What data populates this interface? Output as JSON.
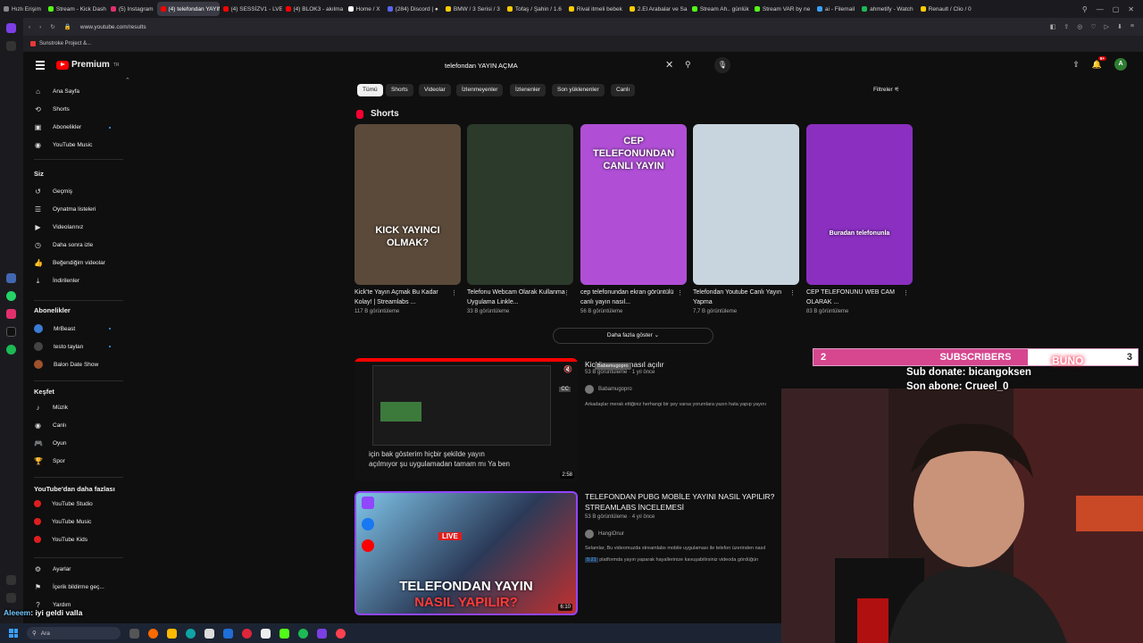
{
  "browser": {
    "tabs": [
      {
        "label": "Hızlı Erişim",
        "color": "#888888"
      },
      {
        "label": "Stream - Kick Dash",
        "color": "#53fc18"
      },
      {
        "label": "(5) Instagram",
        "color": "#e1306c"
      },
      {
        "label": "(4) telefondan YAYIN AÇM",
        "color": "#ff0000",
        "active": true
      },
      {
        "label": "(4) SESSİZV1 - LVE",
        "color": "#ff0000"
      },
      {
        "label": "(4) BLOK3 - akılma",
        "color": "#ff0000"
      },
      {
        "label": "Home / X",
        "color": "#ffffff"
      },
      {
        "label": "(284) Discord | ●",
        "color": "#5865f2"
      },
      {
        "label": "BMW / 3 Serisi / 3",
        "color": "#ffcc00"
      },
      {
        "label": "Tofaş / Şahin / 1.6",
        "color": "#ffcc00"
      },
      {
        "label": "Rival itmeli bebek",
        "color": "#ffcc00"
      },
      {
        "label": "2.El Arabalar ve Sa",
        "color": "#ffcc00"
      },
      {
        "label": "Stream Ah.. günlük",
        "color": "#53fc18"
      },
      {
        "label": "Stream VAR by ne",
        "color": "#53fc18"
      },
      {
        "label": "ai - Filemail",
        "color": "#3aa0ff"
      },
      {
        "label": "ahmetify - Watch",
        "color": "#1db954"
      },
      {
        "label": "Renault / Clio / 0",
        "color": "#ffcc00"
      }
    ],
    "url": "www.youtube.com/results",
    "bookmark": "Sunstroke Project &..."
  },
  "youtube": {
    "logo": "Premium",
    "logo_region": "TR",
    "search_value": "telefondan YAYIN AÇMA",
    "avatar_letter": "A",
    "notification_count": "9+"
  },
  "guide": {
    "main": [
      "Ana Sayfa",
      "Shorts",
      "Abonelikler",
      "YouTube Music"
    ],
    "you_header": "Siz",
    "you": [
      "Geçmiş",
      "Oynatma listeleri",
      "Videolarınız",
      "Daha sonra izle",
      "Beğendiğim videolar",
      "İndirilenler"
    ],
    "subs_header": "Abonelikler",
    "subs": [
      {
        "name": "MrBeast",
        "color": "#3a7bd5"
      },
      {
        "name": "testo taylan",
        "color": "#444444"
      },
      {
        "name": "Balon Date Show",
        "color": "#a0522d"
      }
    ],
    "explore_header": "Keşfet",
    "explore": [
      "Müzik",
      "Canlı",
      "Oyun",
      "Spor"
    ],
    "more_header": "YouTube'dan daha fazlası",
    "more": [
      "YouTube Studio",
      "YouTube Music",
      "YouTube Kids"
    ],
    "settings": [
      "Ayarlar",
      "İçerik bildirme geç...",
      "Yardım"
    ]
  },
  "chips": [
    "Tümü",
    "Shorts",
    "Videolar",
    "İzlenmeyenler",
    "İzlenenler",
    "Son yüklenenler",
    "Canlı"
  ],
  "filters_label": "Filtreler",
  "shorts": {
    "heading": "Shorts",
    "items": [
      {
        "title": "Kick'te Yayın Açmak Bu Kadar Kolay! | Streamlabs ...",
        "views": "117 B görüntüleme",
        "overlay": "KICK YAYINCI OLMAK?",
        "bg": "#5b4a3a"
      },
      {
        "title": "Telefonu Webcam Olarak Kullanma Uygulama Linkle...",
        "views": "33 B görüntüleme",
        "overlay": "",
        "bg": "#2b3a2a"
      },
      {
        "title": "cep telefonundan ekran görüntülü canlı yayın nasıl...",
        "views": "56 B görüntüleme",
        "overlay": "CEP TELEFONUNDAN CANLI YAYIN",
        "bg": "#b04fd6"
      },
      {
        "title": "Telefondan Youtube Canlı Yayın Yapma",
        "views": "7,7 B görüntüleme",
        "overlay": "",
        "bg": "#c8d4de"
      },
      {
        "title": "CEP TELEFONUNU WEB CAM OLARAK ...",
        "views": "83 B görüntüleme",
        "overlay": "Buradan telefonunla",
        "bg": "#8a2fc0"
      }
    ]
  },
  "more_button": "Daha fazla göster",
  "videos": [
    {
      "title": "Kick'te yayın nasıl açılır",
      "meta": "53 B görüntüleme · 1 yıl önce",
      "channel": "Babamugopro",
      "tooltip": "Babamugopro",
      "desc": "Arkadaşlar merak ettiğiniz herhangi bir şey varsa yorumlara yazın hata yapıp yayını",
      "caption1": "için bak gösterim hiçbir şekilde yayın",
      "caption2": "açılmıyor şu uygulamadan tamam mı Ya ben",
      "duration": "2:58"
    },
    {
      "title": "TELEFONDAN PUBG MOBİLE YAYINI NASIL YAPILIR? STREAMLABS İNCELEMESİ",
      "meta": "53 B görüntüleme · 4 yıl önce",
      "channel": "HangiOnur",
      "desc": "Selamlar, Bu videomuzda streamlabs mobile uygulaması ile telefon üzerinden nasıl",
      "desc2": "platformda yayın yaparak hayallerinize kavuşabilirsiniz videoda gördüğün",
      "badge": "5:21",
      "overlay1": "TELEFONDAN YAYIN",
      "overlay2": "NASIL YAPILIR?",
      "duration": "6:10"
    }
  ],
  "stream": {
    "sub_goal_label": "SUBSCRIBERS",
    "sub_current": "2",
    "sub_target": "3",
    "sub_progress": 0.66,
    "donate_line": "Sub donate: bicangoksen",
    "last_sub_line": "Son abone: Crueel_0",
    "neon": "BUNO",
    "chat_nick": "Aleeem",
    "chat_msg": ": iyi geldi valla"
  },
  "taskbar": {
    "search_placeholder": "Ara"
  }
}
